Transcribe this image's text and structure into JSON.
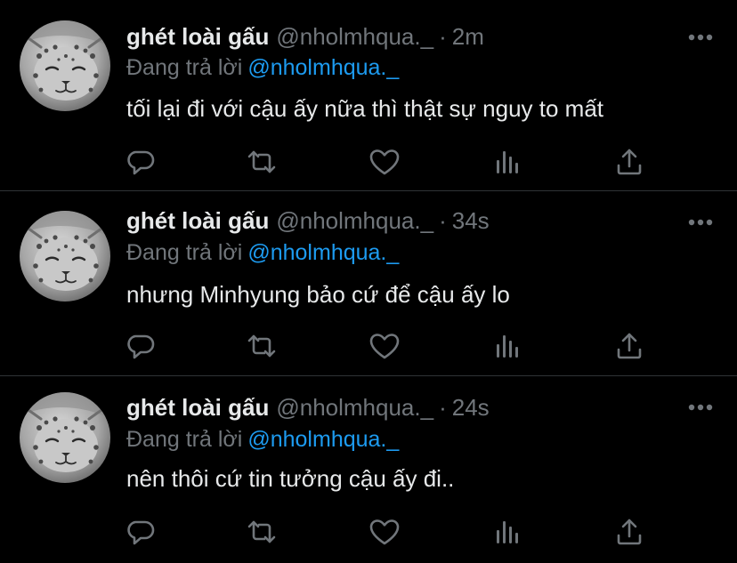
{
  "theme": {
    "background": "#000000",
    "text_primary": "#e7e9ea",
    "text_secondary": "#71767b",
    "accent": "#1d9bf0",
    "divider": "#2f3336"
  },
  "icons": {
    "more": "more-horizontal-icon",
    "reply": "reply-bubble-icon",
    "retweet": "retweet-icon",
    "like": "heart-icon",
    "views": "bar-chart-icon",
    "share": "share-upload-icon"
  },
  "tweets": [
    {
      "display_name": "ghét loài gấu",
      "handle": "@nholmhqua._",
      "separator": "·",
      "time": "2m",
      "reply_prefix": "Đang trả lời",
      "reply_to": "@nholmhqua._",
      "text": "tối lại đi với cậu ấy nữa thì thật sự nguy to mất"
    },
    {
      "display_name": "ghét loài gấu",
      "handle": "@nholmhqua._",
      "separator": "·",
      "time": "34s",
      "reply_prefix": "Đang trả lời",
      "reply_to": "@nholmhqua._",
      "text": "nhưng Minhyung bảo cứ để cậu ấy lo"
    },
    {
      "display_name": "ghét loài gấu",
      "handle": "@nholmhqua._",
      "separator": "·",
      "time": "24s",
      "reply_prefix": "Đang trả lời",
      "reply_to": "@nholmhqua._",
      "text": "nên thôi cứ tin tưởng cậu ấy đi.."
    }
  ]
}
